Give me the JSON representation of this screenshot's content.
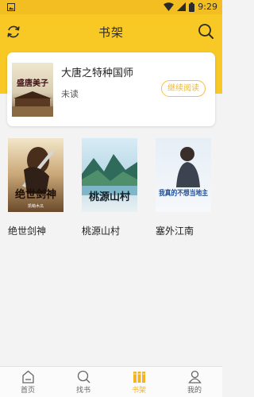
{
  "status_bar": {
    "time": "9:29"
  },
  "header": {
    "title": "书架"
  },
  "recent": {
    "title": "大唐之特种国师",
    "status": "未读",
    "action_label": "继续阅读",
    "cover_text": "盛唐美子"
  },
  "shelf": [
    {
      "title": "绝世剑神",
      "cover_text": "绝世剑神",
      "author": "凯萌木瓜"
    },
    {
      "title": "桃源山村",
      "cover_text": "桃源山村",
      "author": ""
    },
    {
      "title": "塞外江南",
      "cover_text": "我真的不想当地主",
      "author": ""
    }
  ],
  "tabs": [
    {
      "label": "首页",
      "icon": "home-icon"
    },
    {
      "label": "找书",
      "icon": "search-icon"
    },
    {
      "label": "书架",
      "icon": "bookshelf-icon"
    },
    {
      "label": "我的",
      "icon": "person-icon"
    }
  ],
  "colors": {
    "accent": "#f8c825",
    "active_tab": "#f0b429"
  }
}
